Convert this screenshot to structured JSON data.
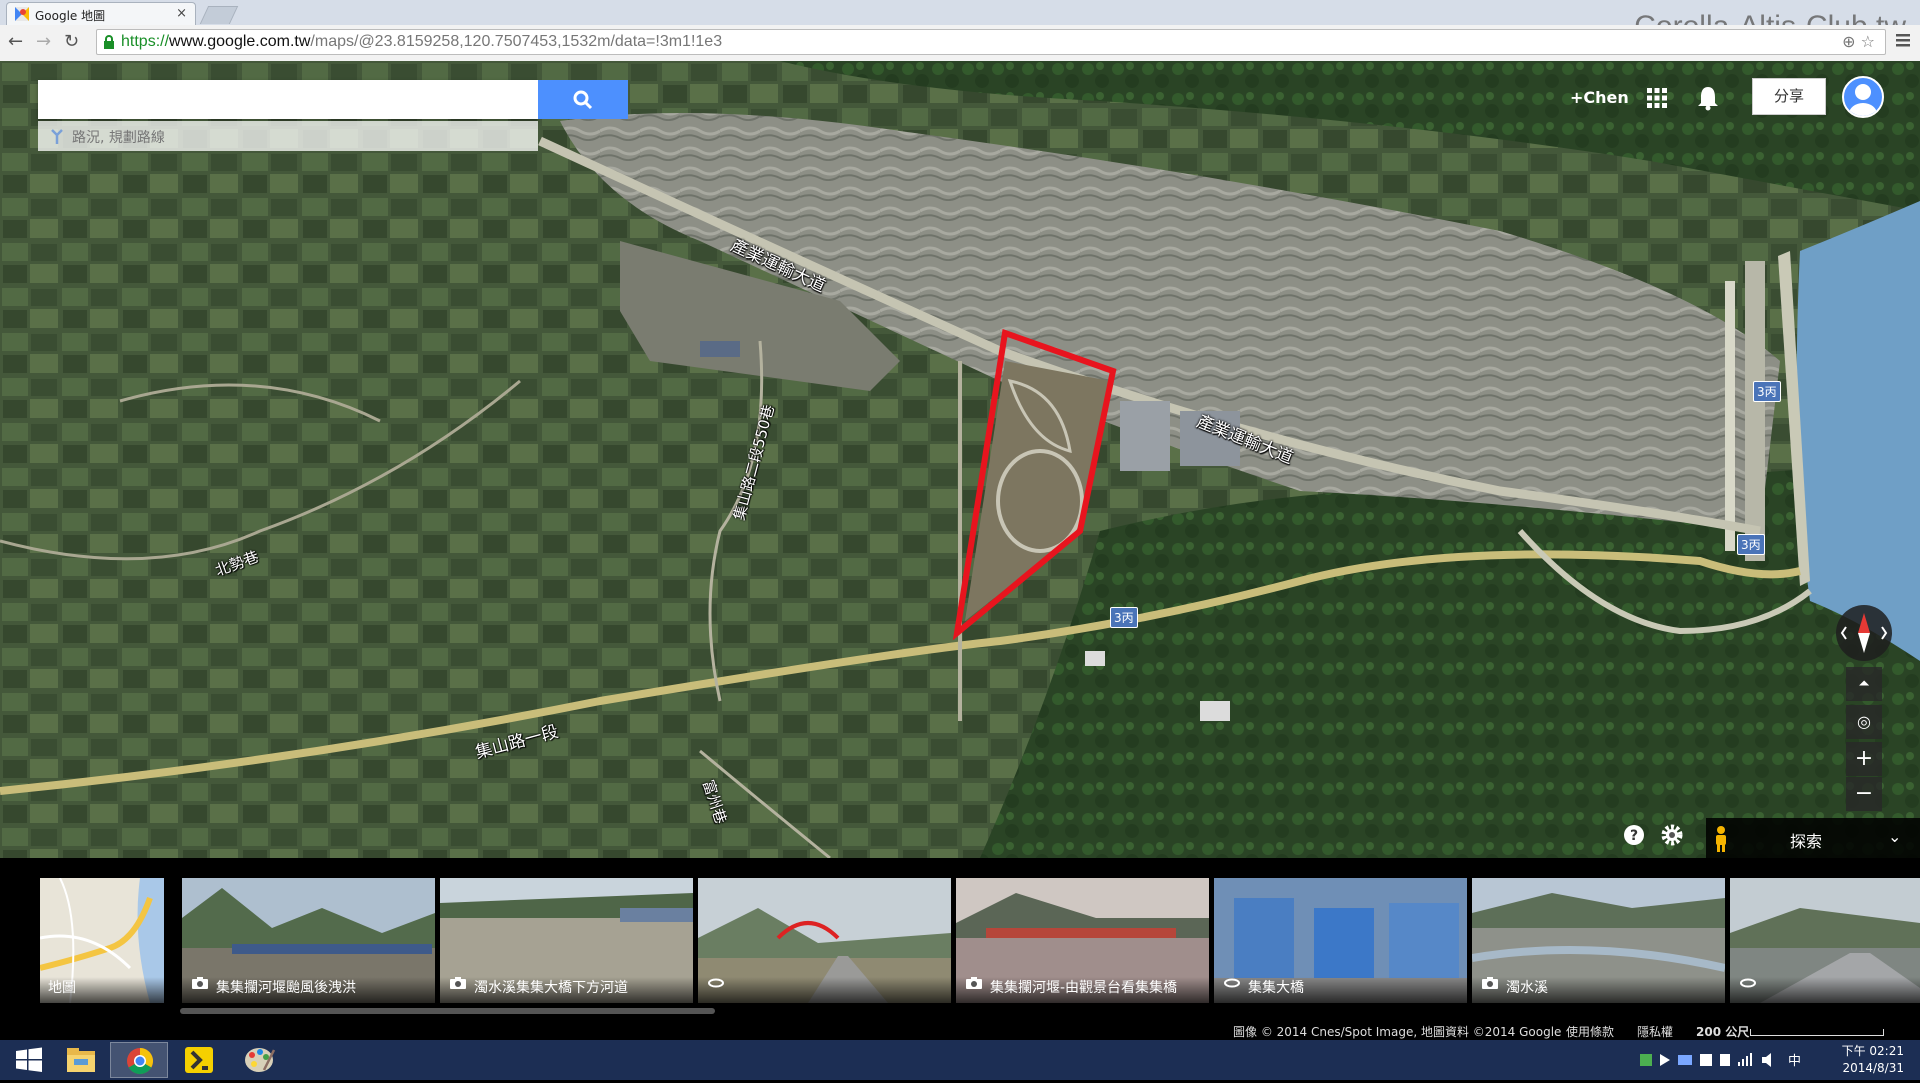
{
  "browser": {
    "tab_title": "Google 地圖",
    "url_scheme": "https://",
    "url_host": "www.google.com.tw",
    "url_rest": "/maps/@23.8159258,120.7507453,1532m/data=!3m1!1e3",
    "watermark": "Corolla-Altis-Club.tw"
  },
  "maps": {
    "search_placeholder": "",
    "directions_hint": "路況, 規劃路線",
    "user_label": "+Chen",
    "share_label": "分享",
    "explore_label": "探索",
    "road_labels": {
      "industrial_road_1": "產業運輸大道",
      "industrial_road_2": "產業運輸大道",
      "lane_550": "集山路二段550巷",
      "beishi_lane": "北勢巷",
      "jishan_road": "集山路一段",
      "fuzhou_lane": "富州巷"
    },
    "route_badges": [
      "3丙",
      "3丙",
      "3丙"
    ]
  },
  "filmstrip": {
    "cards": [
      {
        "label": "地圖",
        "icon": "map-thumb"
      },
      {
        "label": "集集攔河堰颱風後洩洪",
        "icon": "camera-icon"
      },
      {
        "label": "濁水溪集集大橋下方河道",
        "icon": "camera-icon"
      },
      {
        "label": "",
        "icon": "panorama-icon"
      },
      {
        "label": "集集攔河堰-由觀景台看集集橋",
        "icon": "camera-icon"
      },
      {
        "label": "集集大橋",
        "icon": "panorama-icon"
      },
      {
        "label": "濁水溪",
        "icon": "camera-icon"
      },
      {
        "label": "",
        "icon": "panorama-icon"
      }
    ]
  },
  "footer": {
    "attribution": "圖像 © 2014 Cnes/Spot Image, 地圖資料 ©2014 Google",
    "terms": "使用條款",
    "privacy": "隱私權",
    "scale": "200 公尺"
  },
  "taskbar": {
    "time": "下午 02:21",
    "date": "2014/8/31",
    "ime": "中"
  },
  "colors": {
    "search_blue": "#4d90fe",
    "highlight_red": "#e8141e",
    "taskbar": "#1c2e54"
  }
}
